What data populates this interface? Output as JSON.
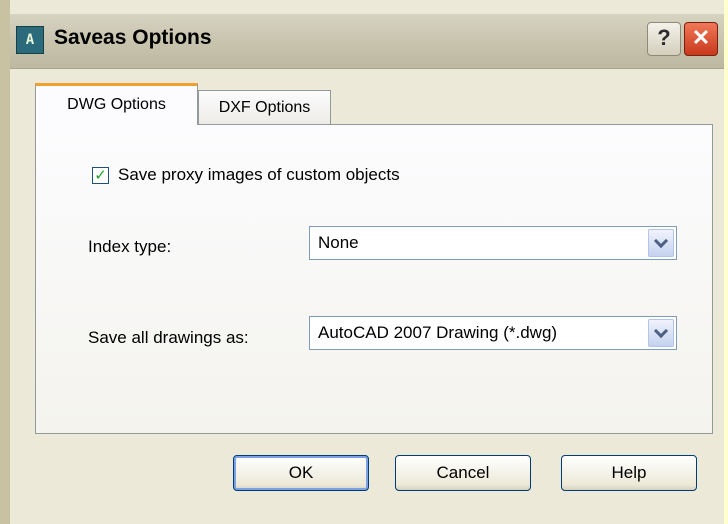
{
  "window": {
    "title": "Saveas Options",
    "app_icon": "autocad-icon",
    "help_glyph": "?",
    "close_glyph": "✕"
  },
  "tabs": [
    {
      "label": "DWG Options",
      "active": true
    },
    {
      "label": "DXF Options",
      "active": false
    }
  ],
  "dwg_options": {
    "proxy_checkbox": {
      "label": "Save proxy images of custom objects",
      "checked": true,
      "check_glyph": "✓"
    },
    "index_type": {
      "label": "Index type:",
      "value": "None"
    },
    "save_as": {
      "label": "Save all drawings as:",
      "value": "AutoCAD 2007 Drawing (*.dwg)"
    }
  },
  "buttons": {
    "ok": "OK",
    "cancel": "Cancel",
    "help": "Help"
  },
  "colors": {
    "background_outside": "#ffffcc",
    "dialog_face": "#ece9d8",
    "active_tab_accent": "#f0a030",
    "close_button": "#d84a2c",
    "checkmark": "#21a121"
  }
}
